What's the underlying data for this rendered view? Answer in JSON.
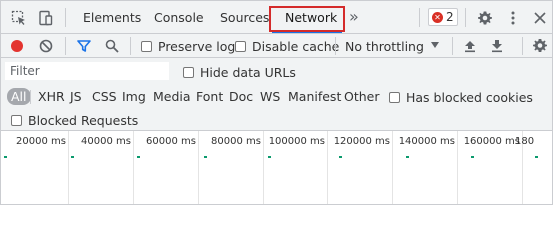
{
  "tabs": {
    "elements": "Elements",
    "console": "Console",
    "sources": "Sources",
    "network": "Network",
    "more": "»"
  },
  "errors": {
    "count": "2"
  },
  "toolbar": {
    "preserve_log": "Preserve log",
    "disable_cache": "Disable cache",
    "throttling": "No throttling"
  },
  "filter": {
    "placeholder": "Filter",
    "hide_data_urls": "Hide data URLs"
  },
  "types": {
    "all": "All",
    "xhr": "XHR",
    "js": "JS",
    "css": "CSS",
    "img": "Img",
    "media": "Media",
    "font": "Font",
    "doc": "Doc",
    "ws": "WS",
    "manifest": "Manifest",
    "other": "Other",
    "has_blocked_cookies": "Has blocked cookies"
  },
  "blocked_requests": "Blocked Requests",
  "timeline": {
    "ticks": [
      "20000 ms",
      "40000 ms",
      "60000 ms",
      "80000 ms",
      "100000 ms",
      "120000 ms",
      "140000 ms",
      "160000 ms",
      "180"
    ]
  },
  "colors": {
    "record": "#e3342f",
    "accent": "#1a73e8",
    "highlight": "#d42b2b",
    "error": "#d93025",
    "timeline_dash": "#0b9a6d"
  },
  "icons": {
    "inspect": "inspect-element-icon",
    "device": "device-toolbar-icon",
    "settings": "gear-icon",
    "menu": "kebab-menu-icon",
    "record": "record-icon",
    "clear": "clear-icon",
    "filter": "filter-icon",
    "search": "search-icon",
    "upload": "import-har-icon",
    "download": "export-har-icon"
  }
}
